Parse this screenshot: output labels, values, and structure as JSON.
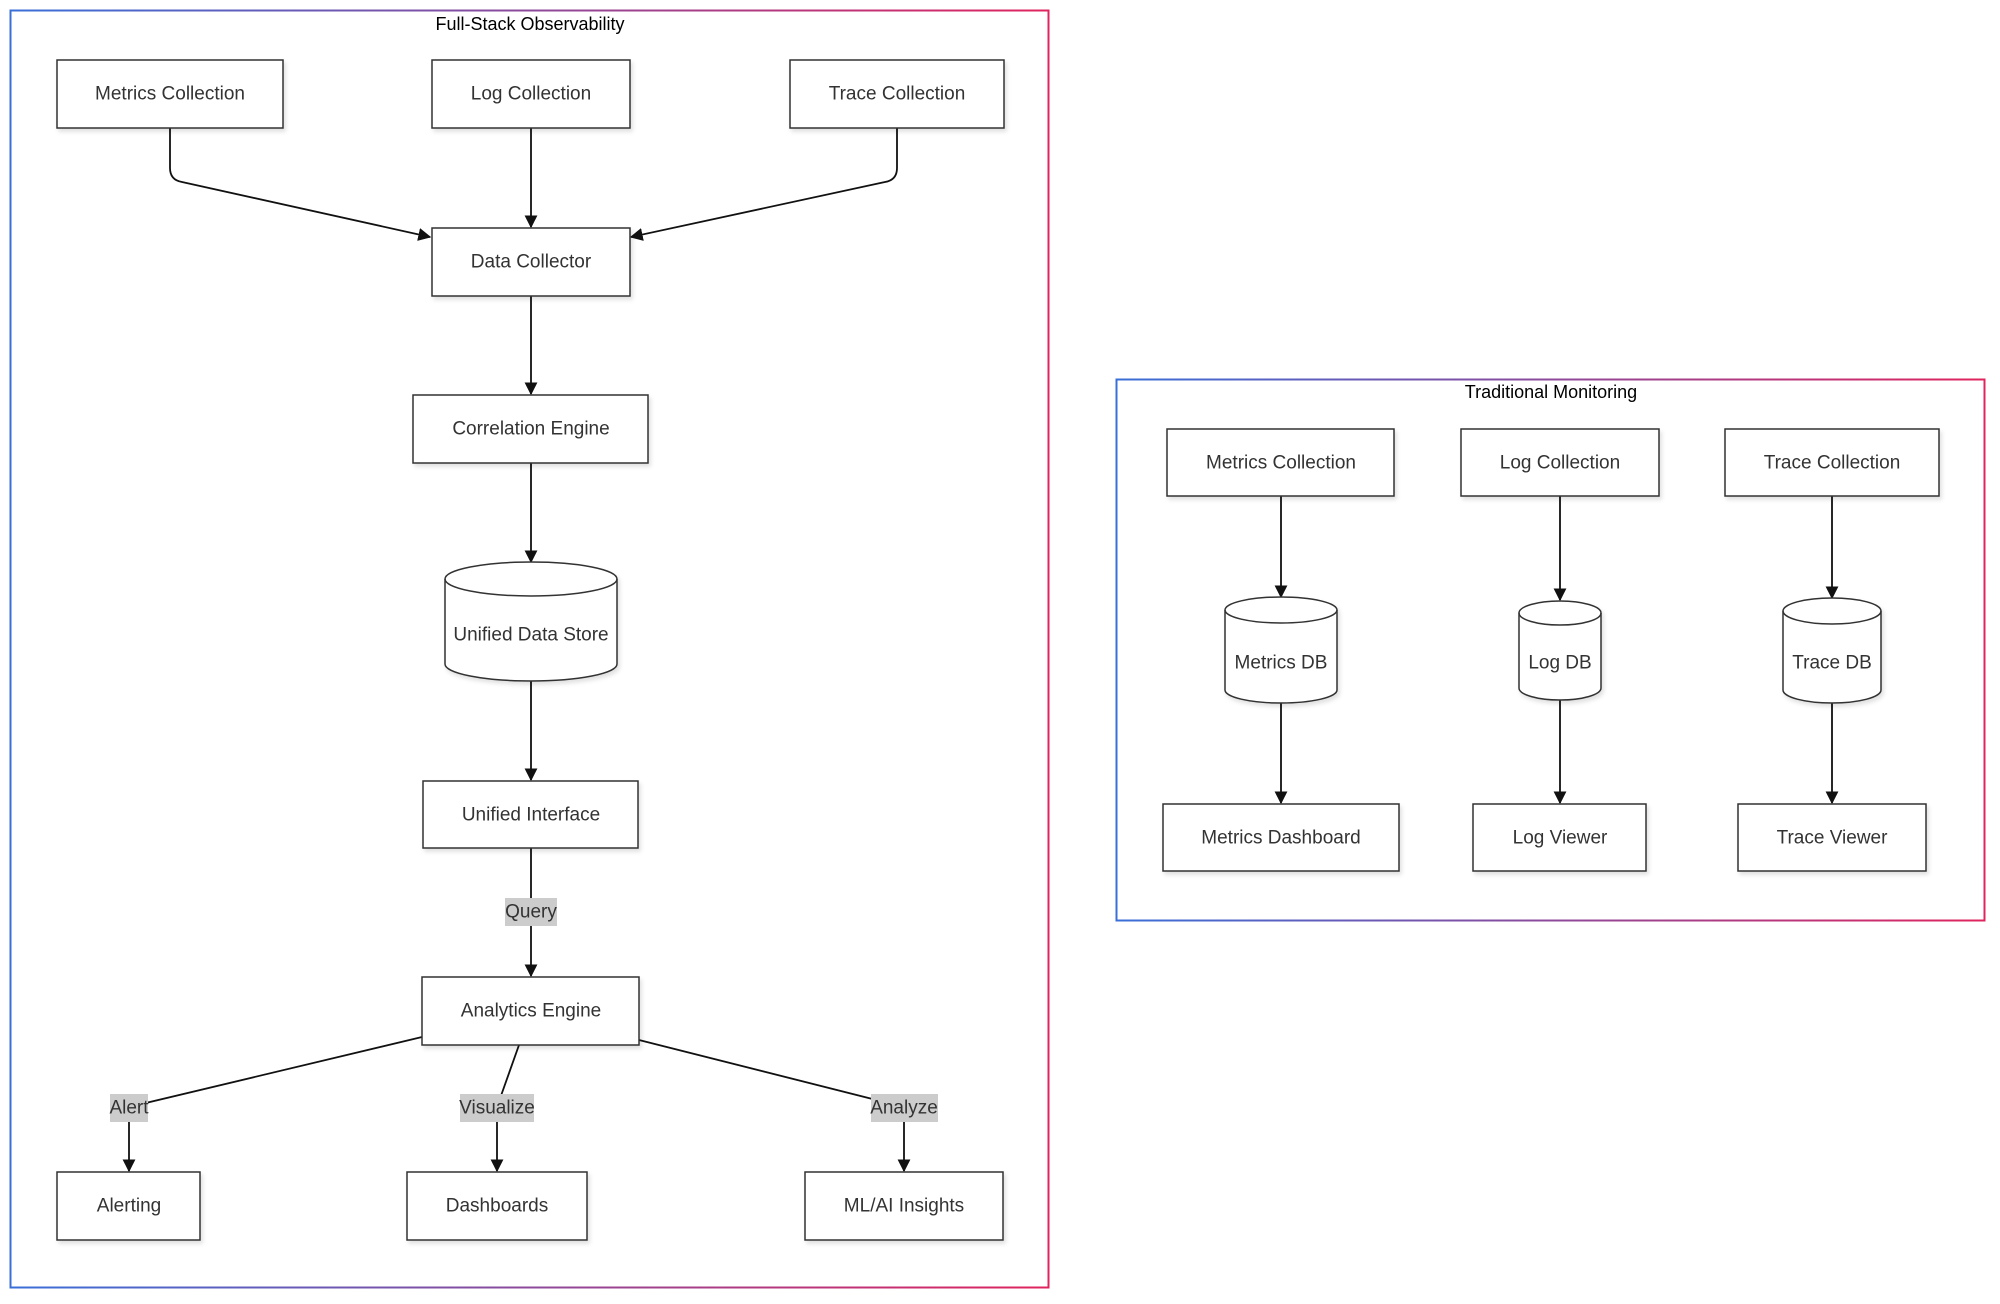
{
  "diagram": {
    "clusters": {
      "full_stack": {
        "title": "Full-Stack Observability",
        "nodes": {
          "metrics_collection": "Metrics Collection",
          "log_collection": "Log Collection",
          "trace_collection": "Trace Collection",
          "data_collector": "Data Collector",
          "correlation_engine": "Correlation Engine",
          "unified_data_store": "Unified Data Store",
          "unified_interface": "Unified Interface",
          "analytics_engine": "Analytics Engine",
          "alerting": "Alerting",
          "dashboards": "Dashboards",
          "ml_ai_insights": "ML/AI Insights"
        },
        "edge_labels": {
          "query": "Query",
          "alert": "Alert",
          "visualize": "Visualize",
          "analyze": "Analyze"
        },
        "edges": [
          {
            "from": "Metrics Collection",
            "to": "Data Collector"
          },
          {
            "from": "Log Collection",
            "to": "Data Collector"
          },
          {
            "from": "Trace Collection",
            "to": "Data Collector"
          },
          {
            "from": "Data Collector",
            "to": "Correlation Engine"
          },
          {
            "from": "Correlation Engine",
            "to": "Unified Data Store"
          },
          {
            "from": "Unified Data Store",
            "to": "Unified Interface"
          },
          {
            "from": "Unified Interface",
            "to": "Analytics Engine",
            "label": "Query"
          },
          {
            "from": "Analytics Engine",
            "to": "Alerting",
            "label": "Alert"
          },
          {
            "from": "Analytics Engine",
            "to": "Dashboards",
            "label": "Visualize"
          },
          {
            "from": "Analytics Engine",
            "to": "ML/AI Insights",
            "label": "Analyze"
          }
        ]
      },
      "traditional": {
        "title": "Traditional Monitoring",
        "nodes": {
          "metrics_collection": "Metrics Collection",
          "log_collection": "Log Collection",
          "trace_collection": "Trace Collection",
          "metrics_db": "Metrics DB",
          "log_db": "Log DB",
          "trace_db": "Trace DB",
          "metrics_dashboard": "Metrics Dashboard",
          "log_viewer": "Log Viewer",
          "trace_viewer": "Trace Viewer"
        },
        "edges": [
          {
            "from": "Metrics Collection",
            "to": "Metrics DB"
          },
          {
            "from": "Metrics DB",
            "to": "Metrics Dashboard"
          },
          {
            "from": "Log Collection",
            "to": "Log DB"
          },
          {
            "from": "Log DB",
            "to": "Log Viewer"
          },
          {
            "from": "Trace Collection",
            "to": "Trace DB"
          },
          {
            "from": "Trace DB",
            "to": "Trace Viewer"
          }
        ]
      }
    },
    "colors": {
      "cluster_gradient_start": "#3a6fd8",
      "cluster_gradient_end": "#e0245e",
      "edge_label_bg": "#cccccc",
      "node_border": "#333333"
    }
  }
}
